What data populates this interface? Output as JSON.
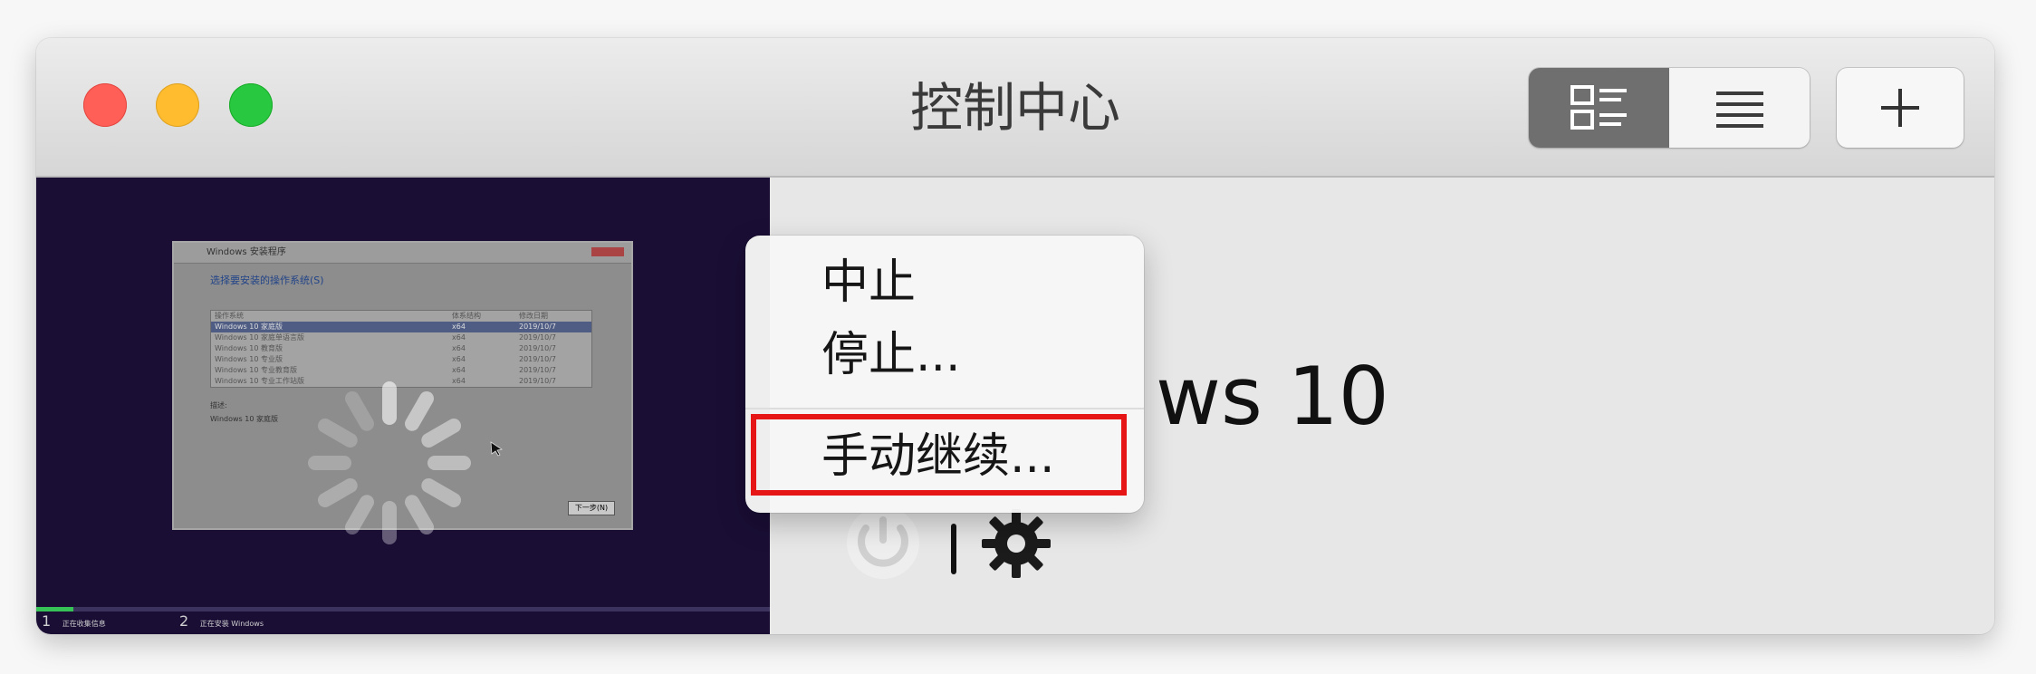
{
  "window": {
    "title": "控制中心"
  },
  "toolbar": {
    "view_mode_buttons": [
      {
        "name": "detail-view",
        "selected": true
      },
      {
        "name": "list-view",
        "selected": false
      }
    ],
    "add_button": "+"
  },
  "thumbnail": {
    "setup_window_title": "Windows 安装程序",
    "heading": "选择要安装的操作系统(S)",
    "columns": [
      "操作系统",
      "体系结构",
      "修改日期"
    ],
    "rows": [
      [
        "Windows 10 家庭版",
        "x64",
        "2019/10/7"
      ],
      [
        "Windows 10 家庭单语言版",
        "x64",
        "2019/10/7"
      ],
      [
        "Windows 10 教育版",
        "x64",
        "2019/10/7"
      ],
      [
        "Windows 10 专业版",
        "x64",
        "2019/10/7"
      ],
      [
        "Windows 10 专业教育版",
        "x64",
        "2019/10/7"
      ],
      [
        "Windows 10 专业工作站版",
        "x64",
        "2019/10/7"
      ]
    ],
    "details_label": "描述:",
    "details_value": "Windows 10 家庭版",
    "next_button": "下一步(N)",
    "progress": 0.05,
    "steps": [
      {
        "number": "1",
        "label": "正在收集信息"
      },
      {
        "number": "2",
        "label": "正在安装 Windows"
      }
    ]
  },
  "vm": {
    "name": "ws 10"
  },
  "context_menu": {
    "items": [
      {
        "label": "中止"
      },
      {
        "label": "停止..."
      },
      {
        "label": "手动继续..."
      }
    ]
  },
  "colors": {
    "close": "#ff5f57",
    "minimize": "#febc2e",
    "maximize": "#28c840",
    "highlight": "#e61616",
    "progress": "#36c256"
  },
  "icons": {
    "detail_view": "detail-view-icon",
    "list_view": "list-view-icon",
    "add": "plus-icon",
    "power": "power-icon",
    "settings": "gear-icon"
  }
}
